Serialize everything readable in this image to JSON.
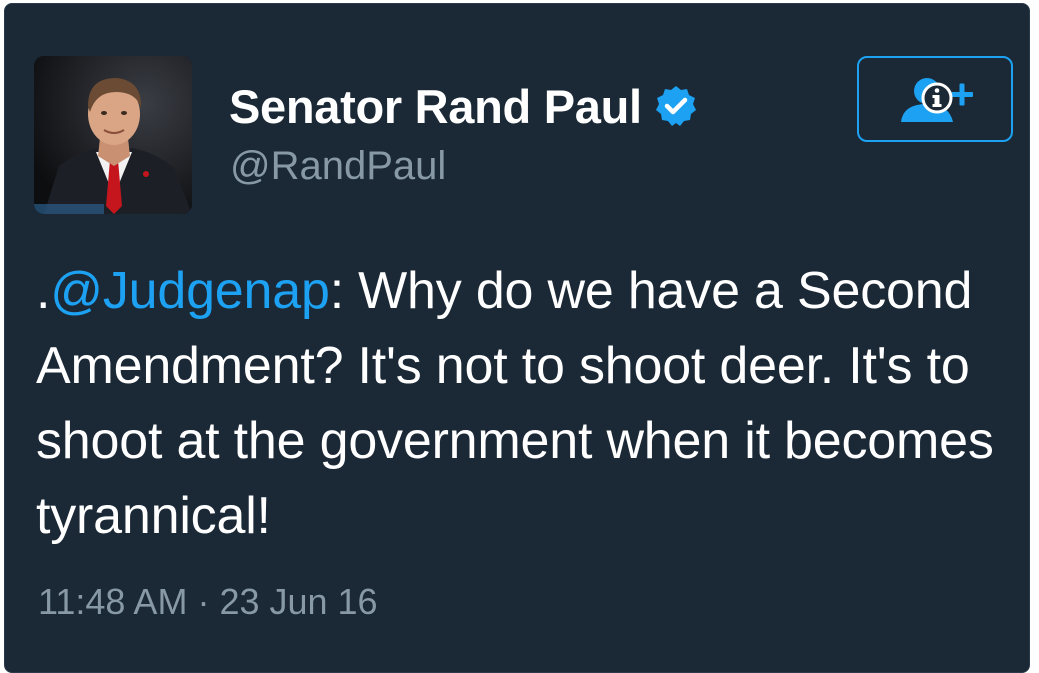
{
  "user": {
    "display_name": "Senator Rand Paul",
    "handle": "@RandPaul",
    "verified": true,
    "verified_icon": "verified-badge-icon"
  },
  "follow_button": {
    "icon": "add-user-icon"
  },
  "tweet": {
    "prefix": ".",
    "mention": "@Judgenap",
    "body": ": Why do we have a Second Amendment? It's not to shoot deer. It's to shoot at the government when it becomes tyrannical!"
  },
  "meta": {
    "time": "11:48 AM",
    "separator": " · ",
    "date": "23 Jun 16"
  },
  "colors": {
    "background": "#1b2836",
    "accent": "#1da1f2",
    "secondary_text": "#8899a6",
    "primary_text": "#ffffff"
  }
}
